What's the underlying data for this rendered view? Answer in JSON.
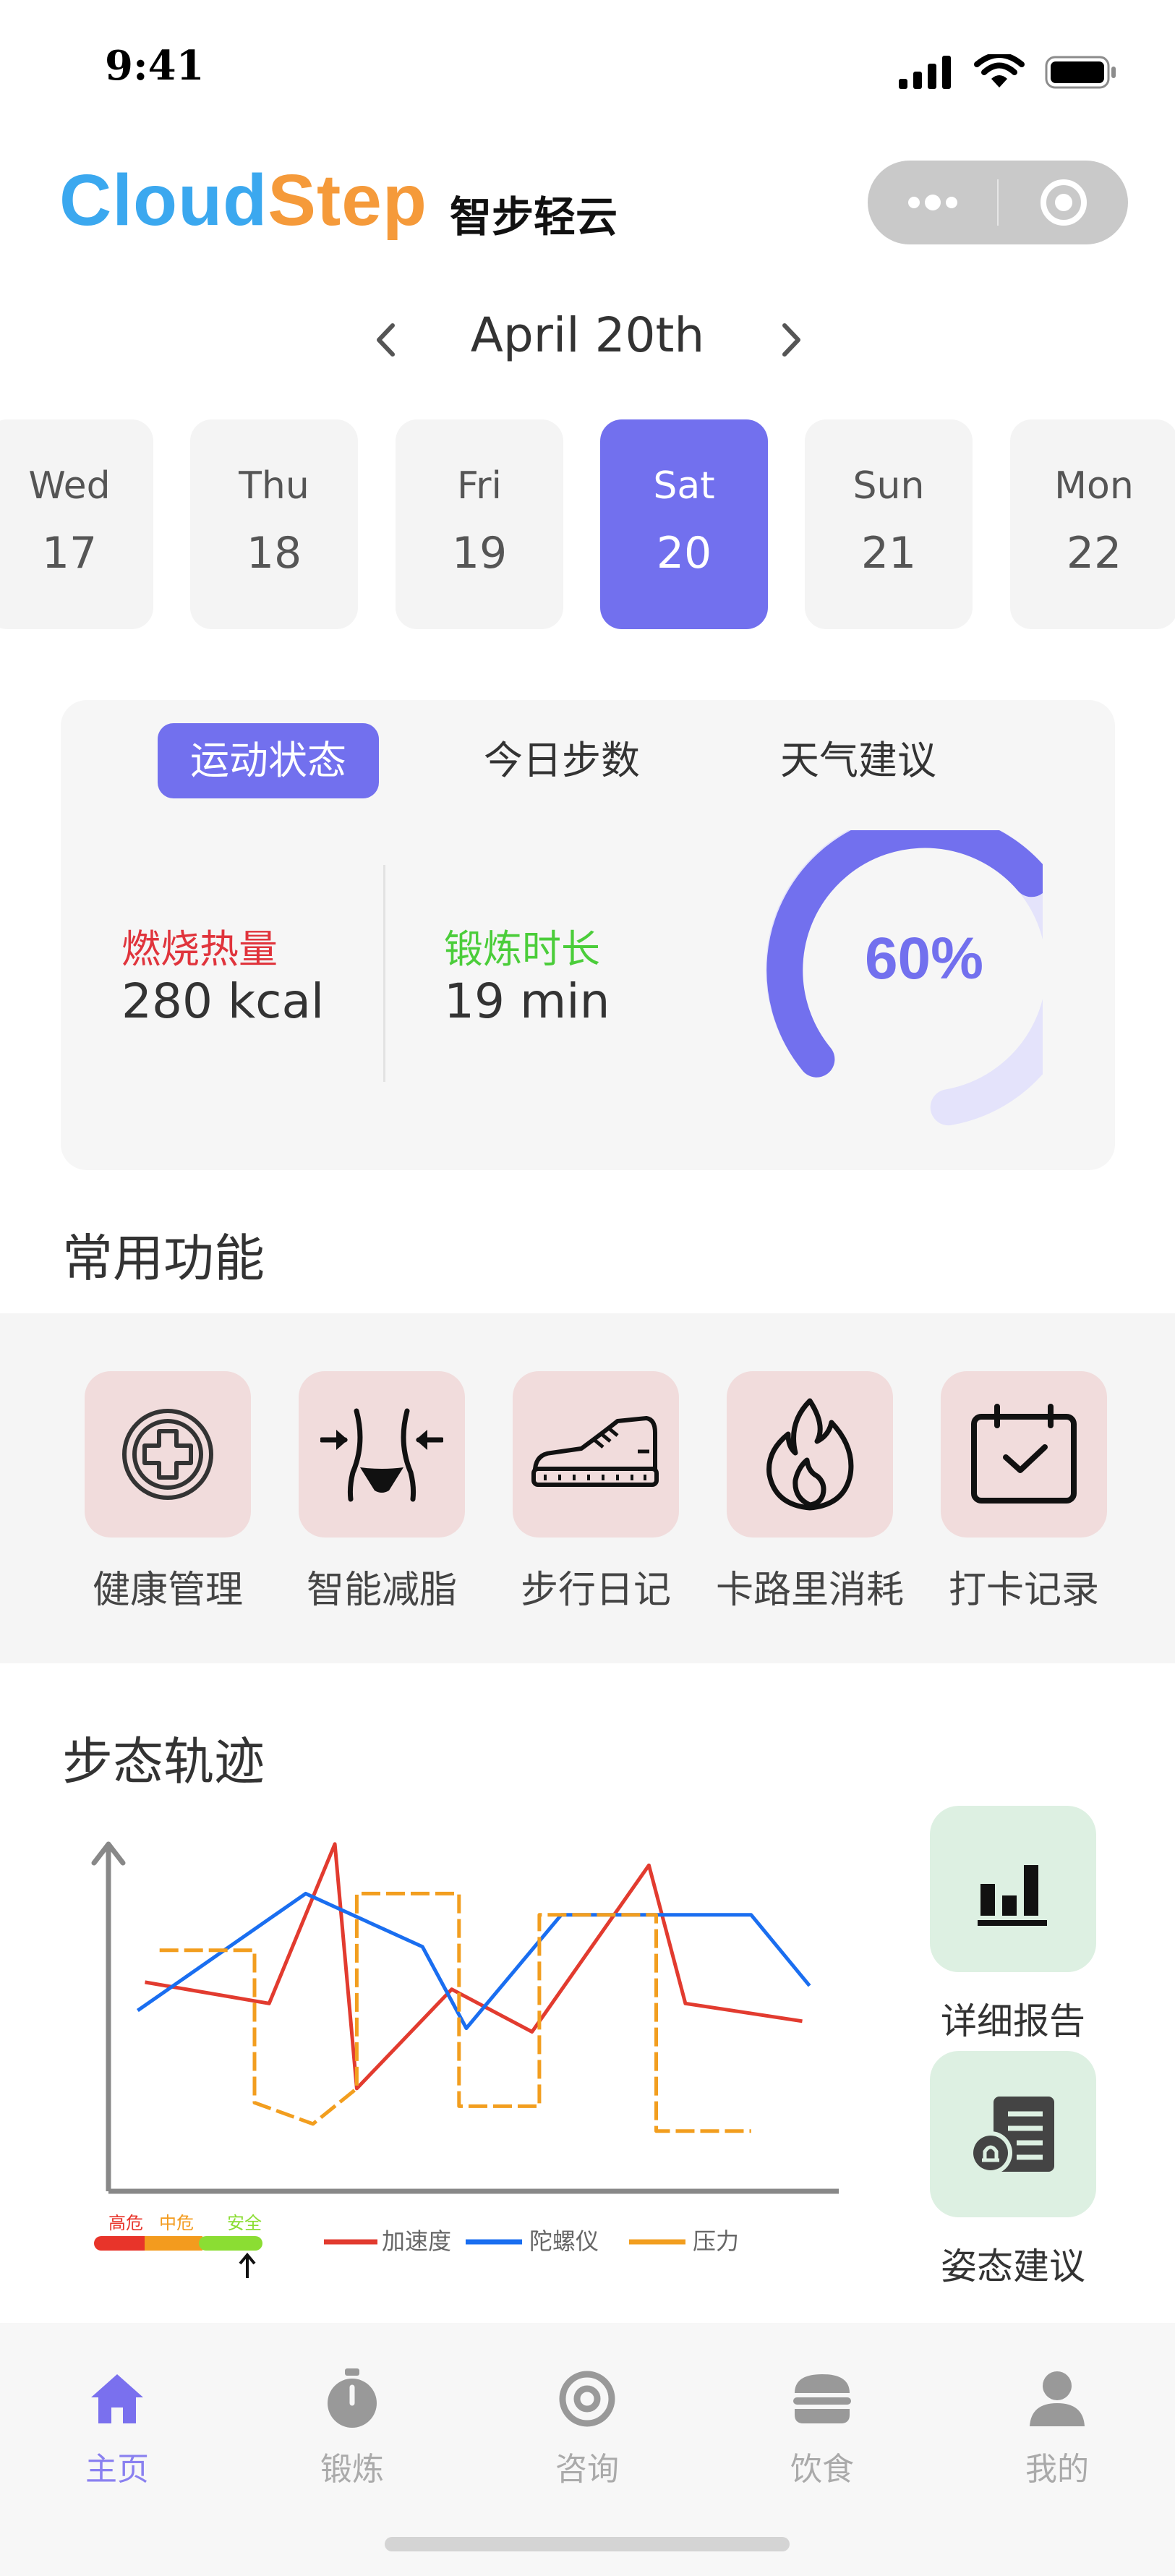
{
  "status_bar": {
    "time": "9:41"
  },
  "header": {
    "brand_part1": "Cloud",
    "brand_part2": "Step",
    "brand_cn": "智步轻云"
  },
  "date_nav": {
    "title": "April 20th"
  },
  "days": [
    {
      "name": "Wed",
      "num": "17"
    },
    {
      "name": "Thu",
      "num": "18"
    },
    {
      "name": "Fri",
      "num": "19"
    },
    {
      "name": "Sat",
      "num": "20"
    },
    {
      "name": "Sun",
      "num": "21"
    },
    {
      "name": "Mon",
      "num": "22"
    }
  ],
  "selected_day": "Sat 20",
  "stats": {
    "tabs": [
      "运动状态",
      "今日步数",
      "天气建议"
    ],
    "active_tab": "运动状态",
    "calories_label": "燃烧热量",
    "calories_value": "280 kcal",
    "duration_label": "锻炼时长",
    "duration_value": "19 min",
    "progress_text": "60%",
    "progress": 0.6,
    "colors": {
      "accent": "#7270ee",
      "calories": "#e0343c",
      "duration": "#4bcd3a"
    }
  },
  "functions": {
    "title": "常用功能",
    "items": [
      {
        "label": "健康管理",
        "icon": "health-cross-icon"
      },
      {
        "label": "智能减脂",
        "icon": "waist-slim-icon"
      },
      {
        "label": "步行日记",
        "icon": "sneaker-icon"
      },
      {
        "label": "卡路里消耗",
        "icon": "flame-icon"
      },
      {
        "label": "打卡记录",
        "icon": "calendar-check-icon"
      }
    ]
  },
  "gait": {
    "title": "步态轨迹",
    "scale_labels": [
      "高危",
      "中危",
      "安全"
    ],
    "legend": [
      "加速度",
      "陀螺仪",
      "压力"
    ],
    "report_label": "详细报告",
    "advice_label": "姿态建议"
  },
  "chart_data": {
    "type": "line",
    "title": "",
    "xlabel": "",
    "ylabel": "",
    "series": [
      {
        "name": "加速度",
        "color": "#e23b2f",
        "style": "solid",
        "points": [
          [
            0.5,
            5.9
          ],
          [
            2.2,
            5.3
          ],
          [
            3.1,
            9.8
          ],
          [
            3.4,
            2.9
          ],
          [
            4.7,
            5.7
          ],
          [
            5.8,
            4.5
          ],
          [
            7.4,
            9.2
          ],
          [
            7.9,
            5.3
          ],
          [
            9.5,
            4.8
          ]
        ]
      },
      {
        "name": "陀螺仪",
        "color": "#1a6ef0",
        "style": "solid",
        "points": [
          [
            0.4,
            5.1
          ],
          [
            2.7,
            8.4
          ],
          [
            4.3,
            6.9
          ],
          [
            4.9,
            4.6
          ],
          [
            6.2,
            7.8
          ],
          [
            8.8,
            7.8
          ],
          [
            9.6,
            5.8
          ]
        ]
      },
      {
        "name": "压力",
        "color": "#f29e1f",
        "style": "dashed-steps",
        "points": [
          [
            0.7,
            6.8
          ],
          [
            2.0,
            6.8
          ],
          [
            2.0,
            2.5
          ],
          [
            2.8,
            1.9
          ],
          [
            3.4,
            2.9
          ],
          [
            3.4,
            8.4
          ],
          [
            4.8,
            8.4
          ],
          [
            4.8,
            2.4
          ],
          [
            5.9,
            2.4
          ],
          [
            5.9,
            7.8
          ],
          [
            7.5,
            7.8
          ],
          [
            7.5,
            1.7
          ],
          [
            8.8,
            1.7
          ]
        ]
      }
    ],
    "xlim": [
      0,
      10
    ],
    "ylim": [
      0,
      10
    ]
  },
  "tabbar": {
    "items": [
      {
        "label": "主页",
        "icon": "home-icon"
      },
      {
        "label": "锻炼",
        "icon": "stopwatch-icon"
      },
      {
        "label": "咨询",
        "icon": "at-sign-icon"
      },
      {
        "label": "饮食",
        "icon": "burger-icon"
      },
      {
        "label": "我的",
        "icon": "user-icon"
      }
    ],
    "active": "主页"
  }
}
